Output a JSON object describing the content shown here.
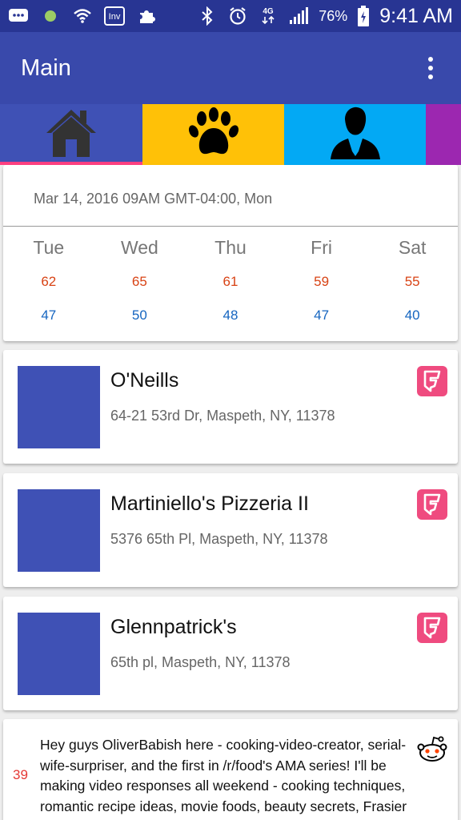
{
  "status_bar": {
    "battery_percent": "76%",
    "time": "9:41 AM",
    "icons": [
      "messages-icon",
      "dot-icon",
      "wifi-icon",
      "inv-icon",
      "puzzle-icon",
      "bluetooth-icon",
      "alarm-icon",
      "4g-lte-icon",
      "signal-icon",
      "battery-icon"
    ],
    "inv_label": "Inv",
    "network_label": "4G"
  },
  "app_bar": {
    "title": "Main"
  },
  "tabs": [
    {
      "name": "home",
      "icon": "home-icon",
      "color": "#3f51b5"
    },
    {
      "name": "pet",
      "icon": "paw-icon",
      "color": "#ffc107"
    },
    {
      "name": "person",
      "icon": "person-icon",
      "color": "#03a9f4"
    },
    {
      "name": "extra",
      "color": "#9c27b0"
    }
  ],
  "weather": {
    "date": "Mar 14, 2016 09AM GMT-04:00, Mon",
    "days": [
      {
        "day": "Tue",
        "high": "62",
        "low": "47"
      },
      {
        "day": "Wed",
        "high": "65",
        "low": "50"
      },
      {
        "day": "Thu",
        "high": "61",
        "low": "48"
      },
      {
        "day": "Fri",
        "high": "59",
        "low": "47"
      },
      {
        "day": "Sat",
        "high": "55",
        "low": "40"
      }
    ]
  },
  "places": [
    {
      "name": "O'Neills",
      "address": "64-21 53rd Dr, Maspeth, NY, 11378"
    },
    {
      "name": "Martiniello's Pizzeria II",
      "address": "5376 65th Pl, Maspeth, NY, 11378"
    },
    {
      "name": "Glennpatrick's",
      "address": "65th pl, Maspeth, NY, 11378"
    }
  ],
  "reddit": {
    "score": "39",
    "text": "Hey guys OliverBabish here - cooking-video-creator, serial-wife-surpriser, and the first in /r/food's AMA series! I'll be making video responses all weekend - cooking techniques, romantic recipe ideas, movie foods, beauty secrets, Frasier trivia, deepest fears/"
  },
  "colors": {
    "status_bar": "#283593",
    "app_bar": "#3949ab",
    "tab_indicator": "#ff4081",
    "foursquare": "#ef4b7f",
    "high_temp": "#d84315",
    "low_temp": "#1565c0",
    "thumb": "#3f51b5"
  }
}
